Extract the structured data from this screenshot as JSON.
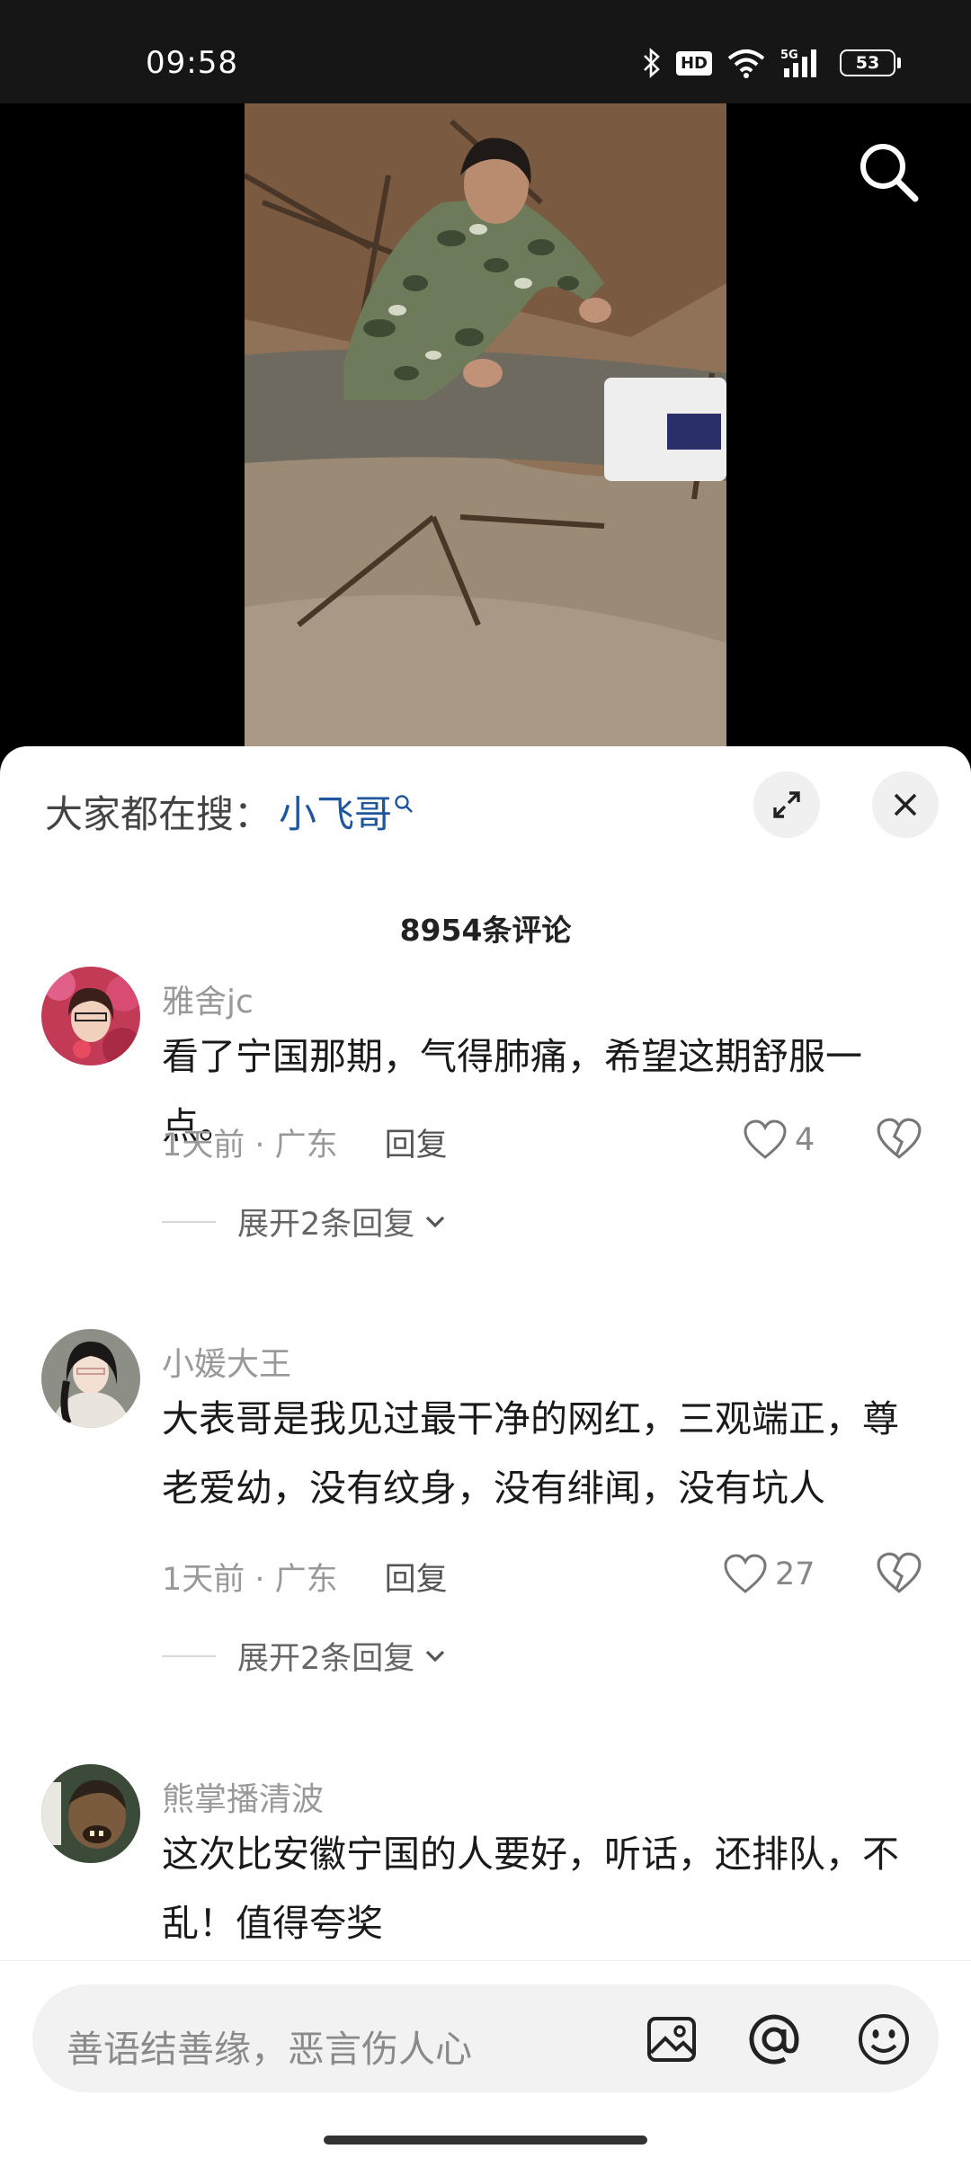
{
  "status": {
    "time": "09:58",
    "hd": "HD",
    "network": "5G",
    "battery": "53"
  },
  "search_bar": {
    "prefix": "大家都在搜：",
    "keyword": "小飞哥"
  },
  "comment_count": "8954条评论",
  "comments": [
    {
      "user": "雅舍jc",
      "text": "看了宁国那期，气得肺痛，希望这期舒服一点。",
      "time_loc": "1天前 · 广东",
      "reply": "回复",
      "likes": "4",
      "expand": "展开2条回复"
    },
    {
      "user": "小媛大王",
      "text": "大表哥是我见过最干净的网红，三观端正，尊老爱幼，没有纹身，没有绯闻，没有坑人",
      "time_loc": "1天前 · 广东",
      "reply": "回复",
      "likes": "27",
      "expand": "展开2条回复"
    },
    {
      "user": "熊掌播清波",
      "text": "这次比安徽宁国的人要好，听话，还排队，不乱！值得夸奖"
    }
  ],
  "input": {
    "placeholder": "善语结善缘，恶言伤人心"
  },
  "icons": [
    "bluetooth-icon",
    "wifi-icon",
    "signal-icon",
    "battery-icon",
    "search-icon",
    "expand-icon",
    "close-icon",
    "heart-icon",
    "broken-heart-icon",
    "chevron-down-icon",
    "image-icon",
    "at-icon",
    "emoji-icon"
  ]
}
